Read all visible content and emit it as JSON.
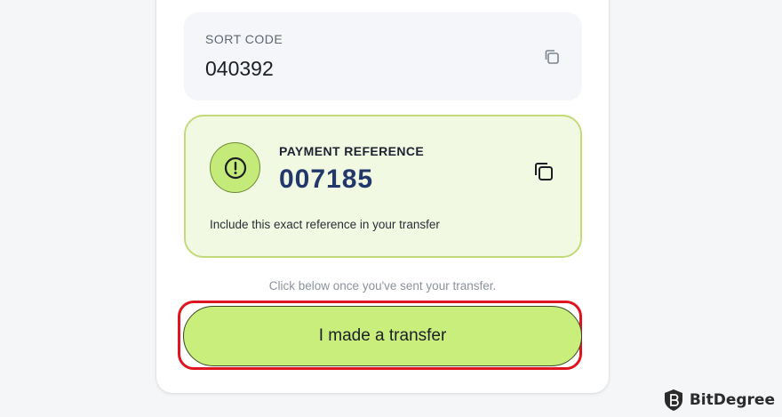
{
  "sort_code": {
    "label": "SORT CODE",
    "value": "040392",
    "copy_icon": "copy-icon"
  },
  "payment_reference": {
    "label": "PAYMENT REFERENCE",
    "value": "007185",
    "note": "Include this exact reference in your transfer",
    "status_icon": "exclamation-circle-icon",
    "copy_icon": "copy-icon"
  },
  "hint": "Click below once you've sent your transfer.",
  "confirm_button": {
    "label": "I made a transfer"
  },
  "watermark": {
    "text": "BitDegree"
  },
  "colors": {
    "accent_green": "#c9ee7b",
    "reference_text": "#22386b",
    "highlight_red": "#e0141f"
  }
}
